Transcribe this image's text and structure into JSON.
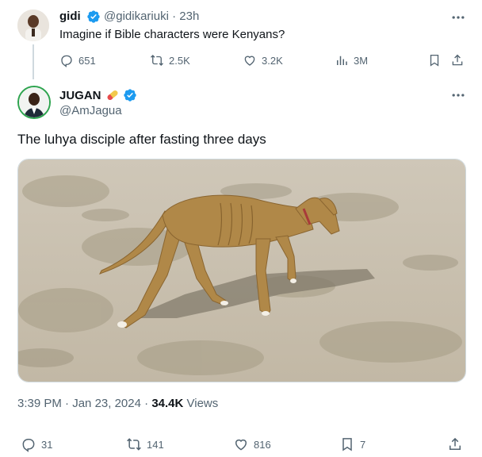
{
  "parent_tweet": {
    "name": "gidi",
    "handle": "@gidikariuki",
    "separator": "·",
    "time": "23h",
    "text": "Imagine if Bible characters were Kenyans?",
    "stats": {
      "replies": "651",
      "reposts": "2.5K",
      "likes": "3.2K",
      "views": "3M"
    }
  },
  "main_tweet": {
    "name": "JUGAN",
    "handle": "@AmJagua",
    "text": "The luhya disciple after fasting three days",
    "time": "3:39 PM",
    "separator": "·",
    "date": "Jan 23, 2024",
    "dot": "·",
    "views_count": "34.4K",
    "views_label": "Views",
    "stats": {
      "replies": "31",
      "reposts": "141",
      "likes": "816",
      "bookmarks": "7"
    }
  },
  "icons": {
    "verified": "verified-badge-icon",
    "more": "more-options-icon",
    "reply": "reply-icon",
    "repost": "repost-icon",
    "like": "like-icon",
    "views": "views-icon",
    "bookmark": "bookmark-icon",
    "share": "share-icon",
    "pill": "pill-emoji-icon"
  },
  "colors": {
    "verified_blue": "#1d9bf0",
    "text": "#0f1419",
    "muted": "#536471",
    "thread_line": "#cfd9de",
    "avatar_ring": "#2ea44f"
  }
}
